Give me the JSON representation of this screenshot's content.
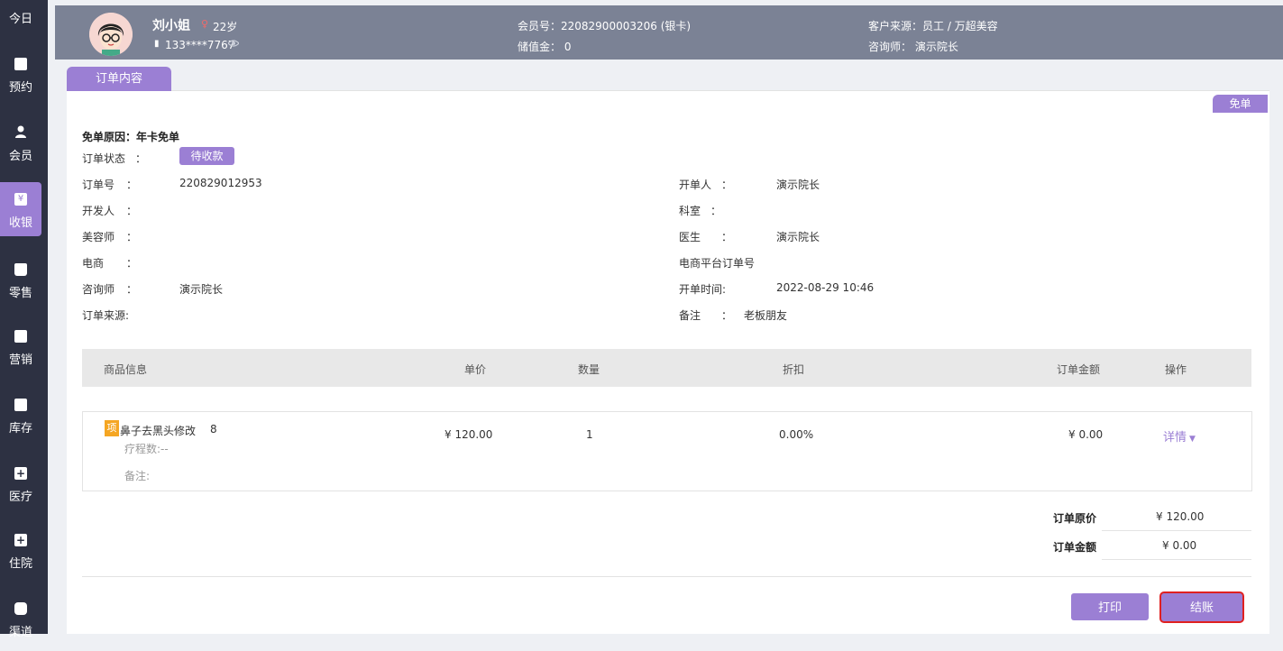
{
  "sidebar": {
    "items": [
      {
        "label": "今日",
        "icon": "star-icon"
      },
      {
        "label": "预约",
        "icon": "calendar-check-icon"
      },
      {
        "label": "会员",
        "icon": "user-icon"
      },
      {
        "label": "收银",
        "icon": "yen-icon",
        "active": true
      },
      {
        "label": "零售",
        "icon": "bag-icon"
      },
      {
        "label": "营销",
        "icon": "bookmark-icon"
      },
      {
        "label": "库存",
        "icon": "archive-icon"
      },
      {
        "label": "医疗",
        "icon": "medical-case-icon"
      },
      {
        "label": "住院",
        "icon": "hospital-icon"
      },
      {
        "label": "渠道",
        "icon": "database-icon"
      }
    ]
  },
  "customer": {
    "name": "刘小姐",
    "age": "22岁",
    "phone": "133****7767",
    "member_no": "会员号：22082900003206 (银卡)",
    "stored_value": "储值金：  0",
    "source": "客户来源：员工 / 万超美容",
    "consultant": "咨询师：  演示院长"
  },
  "tab": {
    "label": "订单内容"
  },
  "badge": "免单",
  "order": {
    "waive_reason": "免单原因：年卡免单",
    "status_label": "订单状态",
    "status_value": "待收款",
    "colon": "：",
    "order_no_label": "订单号",
    "order_no": "220829012953",
    "developer_label": "开发人",
    "beautician_label": "美容师",
    "ecommerce_label": "电商",
    "consultant_label": "咨询师",
    "consultant": "演示院长",
    "source_label": "订单来源:",
    "creator_label": "开单人",
    "creator": "演示院长",
    "dept_label": "科室",
    "doctor_label": "医生",
    "doctor": "演示院长",
    "platform_no_label": "电商平台订单号",
    "open_time_label": "开单时间:",
    "open_time": "2022-08-29 10:46",
    "remark_label": "备注",
    "remark": "老板朋友"
  },
  "table": {
    "headers": [
      "商品信息",
      "单价",
      "数量",
      "折扣",
      "订单金额",
      "操作"
    ],
    "rows": [
      {
        "tag": "项",
        "name": "鼻子去黑头修改",
        "count": "8",
        "course": "疗程数:--",
        "note": "备注:",
        "price": "¥ 120.00",
        "qty": "1",
        "discount": "0.00%",
        "amount": "¥ 0.00",
        "action": "详情"
      }
    ]
  },
  "summary": {
    "original_label": "订单原价",
    "original": "¥ 120.00",
    "amount_label": "订单金额",
    "amount": "¥ 0.00"
  },
  "actions": {
    "print": "打印",
    "checkout": "结账"
  },
  "colors": {
    "accent": "#9b7fd4",
    "header_bg": "#7b8295",
    "sidebar_bg": "#2d3142",
    "highlight": "#e02020"
  }
}
